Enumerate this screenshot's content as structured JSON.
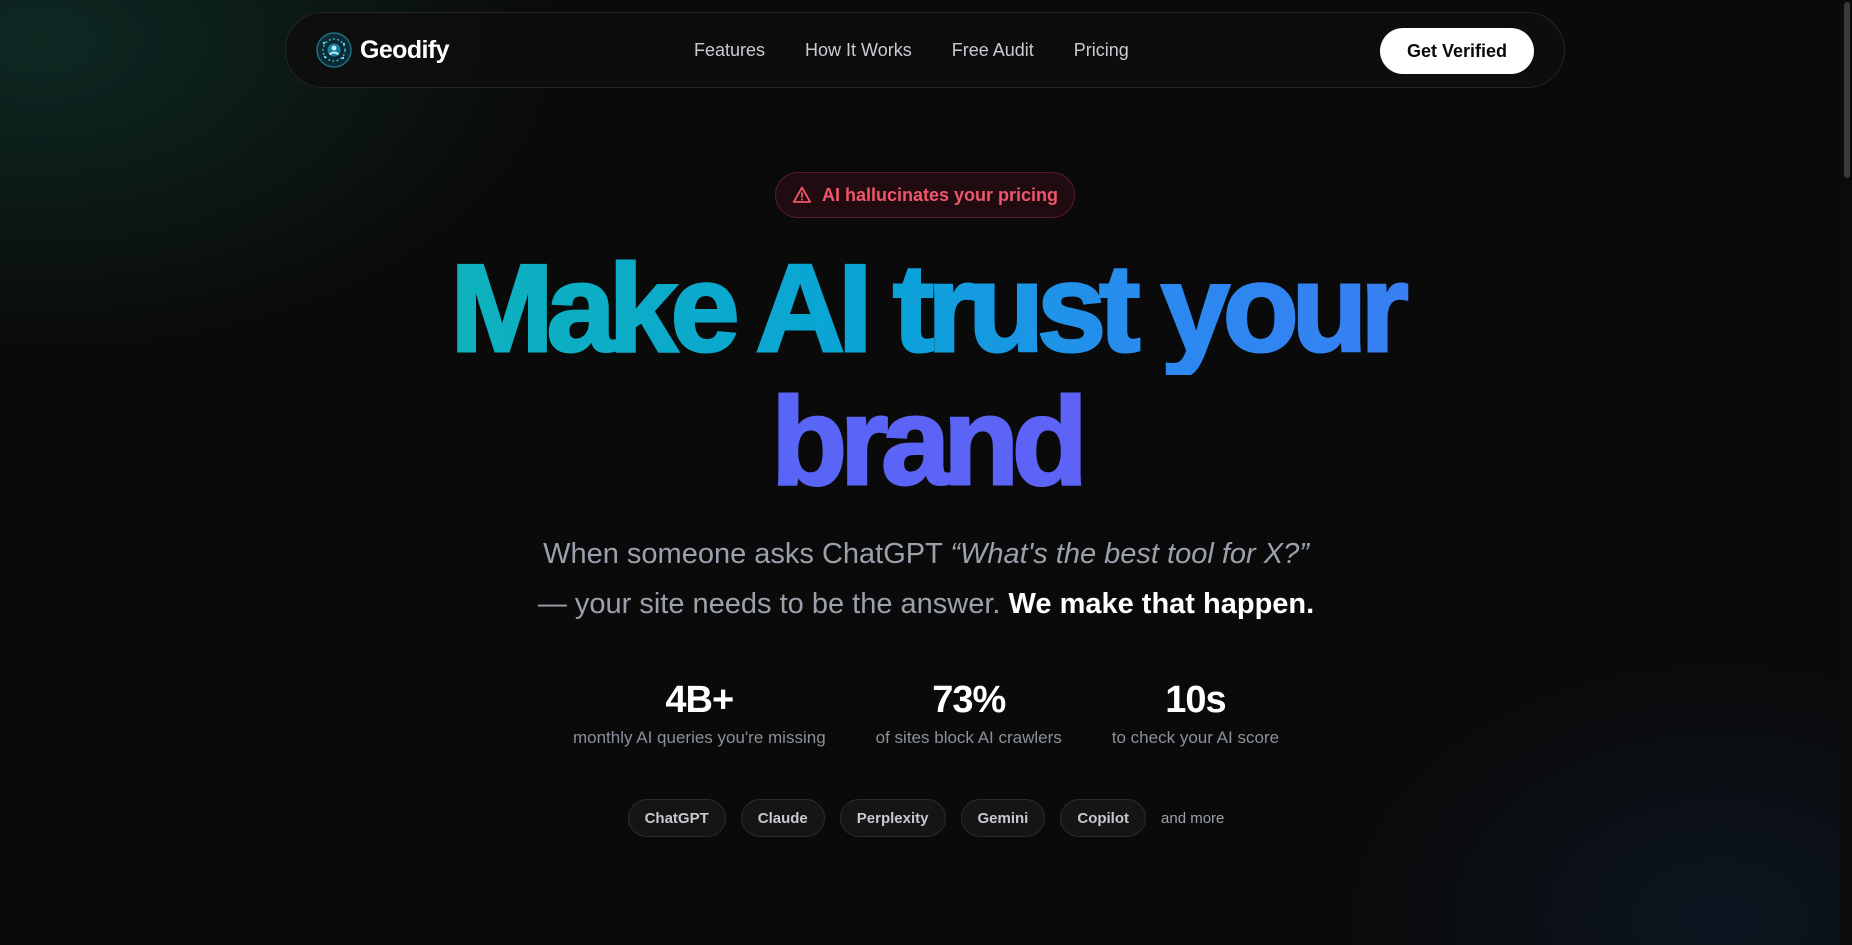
{
  "nav": {
    "brand_name": "Geodify",
    "logo_icon": "globe-logo-icon",
    "links": [
      "Features",
      "How It Works",
      "Free Audit",
      "Pricing"
    ],
    "cta_label": "Get Verified"
  },
  "hero": {
    "badge": {
      "icon": "warning-triangle-icon",
      "text": "AI hallucinates your pricing",
      "color": "#f0566a"
    },
    "headline": {
      "line1": "Make AI trust your",
      "line2": "brand",
      "gradient": [
        "#10c2a0",
        "#0aa3d8",
        "#4f6cf6",
        "#6a5cf6"
      ]
    },
    "subtext": {
      "part1": "When someone asks ChatGPT ",
      "quote": "“What's the best tool for X?”",
      "part2": "— your site needs to be the answer. ",
      "emphasis": "We make that happen."
    },
    "stats": [
      {
        "value": "4B+",
        "label": "monthly AI queries you're missing"
      },
      {
        "value": "73%",
        "label": "of sites block AI crawlers"
      },
      {
        "value": "10s",
        "label": "to check your AI score"
      }
    ],
    "platforms": [
      "ChatGPT",
      "Claude",
      "Perplexity",
      "Gemini",
      "Copilot"
    ],
    "platforms_more": "and more"
  },
  "colors": {
    "background": "#0a0a0a",
    "accent_teal": "#10c2a0",
    "accent_blue": "#2a8af0",
    "accent_violet": "#6a5cf6"
  }
}
